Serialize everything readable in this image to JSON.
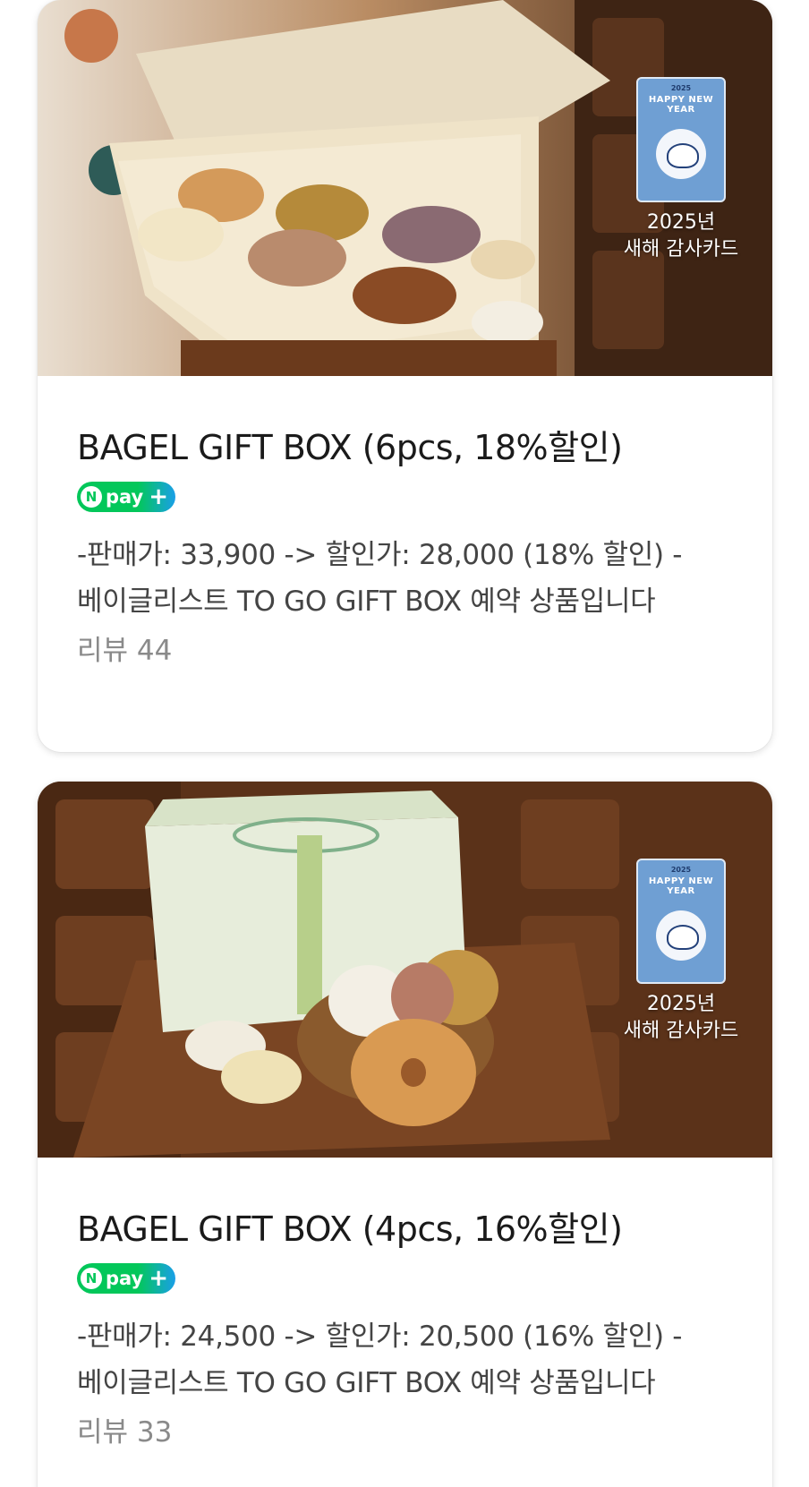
{
  "products": [
    {
      "image_overlay_text": [
        "2025년",
        "새해 감사카드"
      ],
      "card_year": "2025",
      "card_greeting": "HAPPY NEW YEAR",
      "title": "BAGEL GIFT BOX (6pcs, 18%할인)",
      "badge": {
        "n": "N",
        "word": "pay",
        "plus": "+"
      },
      "desc_line1": "-판매가: 33,900 -> 할인가: 28,000 (18% 할인) -",
      "desc_line2": "베이글리스트 TO GO GIFT BOX 예약 상품입니다",
      "review": "리뷰 44"
    },
    {
      "image_overlay_text": [
        "2025년",
        "새해 감사카드"
      ],
      "card_year": "2025",
      "card_greeting": "HAPPY NEW YEAR",
      "title": "BAGEL GIFT BOX (4pcs, 16%할인)",
      "badge": {
        "n": "N",
        "word": "pay",
        "plus": "+"
      },
      "desc_line1": "-판매가: 24,500 -> 할인가: 20,500 (16% 할인) -",
      "desc_line2": "베이글리스트 TO GO GIFT BOX 예약 상품입니다",
      "review": "리뷰 33"
    }
  ],
  "colors": {
    "npay_green": "#03c75a",
    "npay_blue": "#1a9fe8",
    "title": "#1a1a1a",
    "desc": "#444444",
    "review": "#8a8a8a"
  }
}
